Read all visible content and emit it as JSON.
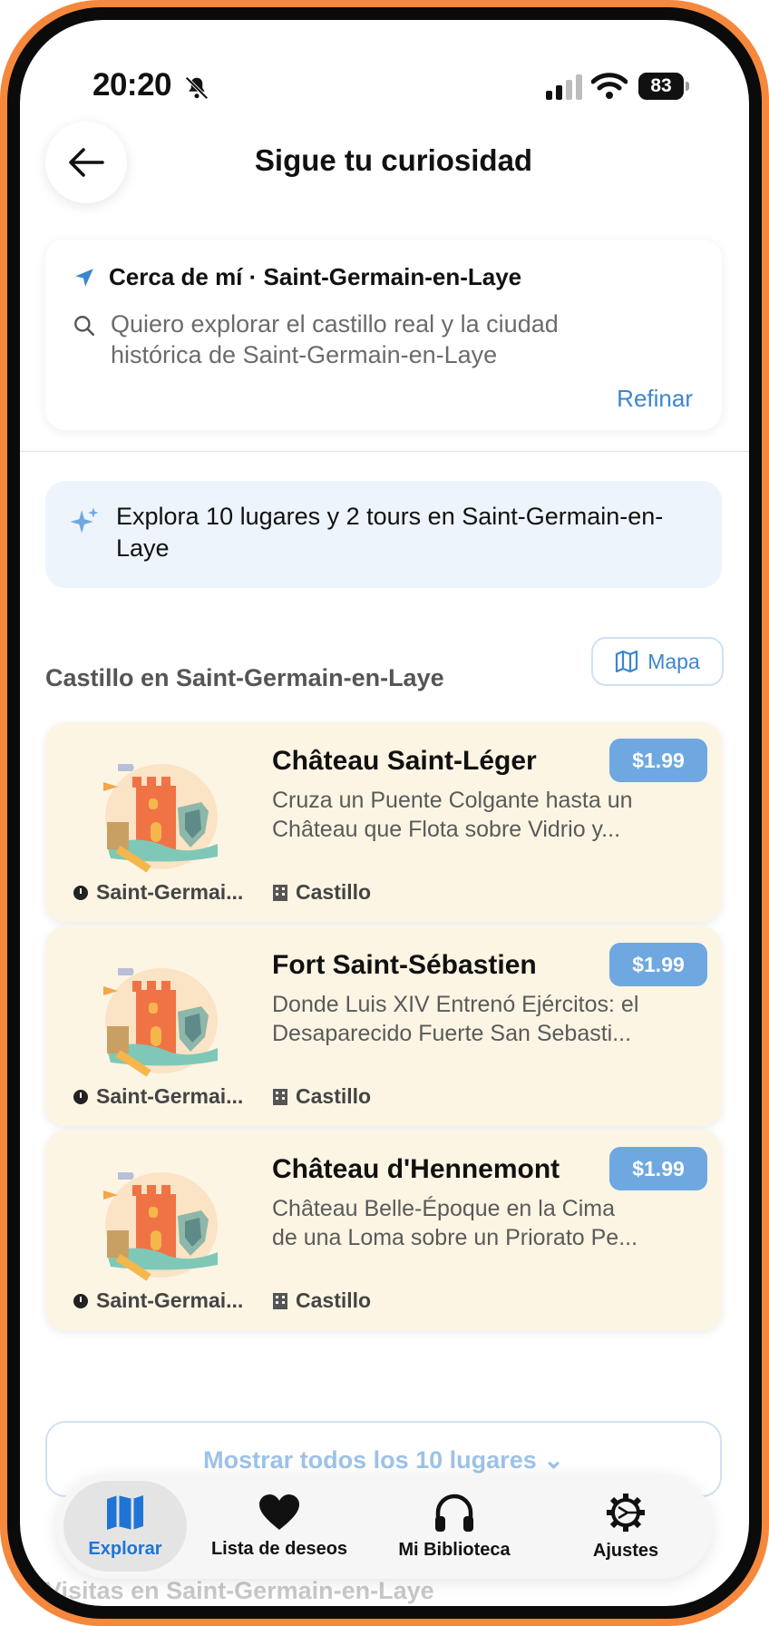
{
  "status_bar": {
    "time": "20:20",
    "battery": "83"
  },
  "header": {
    "title": "Sigue tu curiosidad"
  },
  "search": {
    "location": "Cerca de mí · Saint-Germain-en-Laye",
    "query_line1": "Quiero explorar el castillo real y la ciudad",
    "query_line2": "histórica de Saint-Germain-en-Laye",
    "refine_label": "Refinar"
  },
  "banner": {
    "text": "Explora 10 lugares y 2 tours en Saint-Germain-en-Laye"
  },
  "section": {
    "title": "Castillo en Saint-Germain-en-Laye",
    "map_label": "Mapa"
  },
  "places": [
    {
      "name": "Château Saint-Léger",
      "desc_line1": "Cruza un Puente Colgante hasta un",
      "desc_line2": "Château que Flota sobre Vidrio y...",
      "price": "$1.99",
      "location": "Saint-Germai...",
      "type": "Castillo"
    },
    {
      "name": "Fort Saint-Sébastien",
      "desc_line1": "Donde Luis XIV Entrenó Ejércitos: el",
      "desc_line2": "Desaparecido Fuerte San Sebasti...",
      "price": "$1.99",
      "location": "Saint-Germai...",
      "type": "Castillo"
    },
    {
      "name": "Château d'Hennemont",
      "desc_line1": "Château Belle-Époque en la Cima",
      "desc_line2": "de una Loma sobre un Priorato Pe...",
      "price": "$1.99",
      "location": "Saint-Germai...",
      "type": "Castillo"
    }
  ],
  "show_all": {
    "label": "Mostrar todos los 10 lugares"
  },
  "next_section": {
    "title": "Visitas en Saint-Germain-en-Laye"
  },
  "tabs": [
    {
      "label": "Explorar",
      "icon": "map-icon",
      "active": true
    },
    {
      "label": "Lista de deseos",
      "icon": "heart-icon",
      "active": false
    },
    {
      "label": "Mi Biblioteca",
      "icon": "headphones-icon",
      "active": false
    },
    {
      "label": "Ajustes",
      "icon": "gear-icon",
      "active": false
    }
  ],
  "colors": {
    "accent": "#3A86D0",
    "active_tab": "#1F74D6",
    "card_bg": "#FDF5E4",
    "price_bg": "#6FA8E0",
    "banner_bg": "#EEF4FC",
    "frame": "#F5883C"
  }
}
